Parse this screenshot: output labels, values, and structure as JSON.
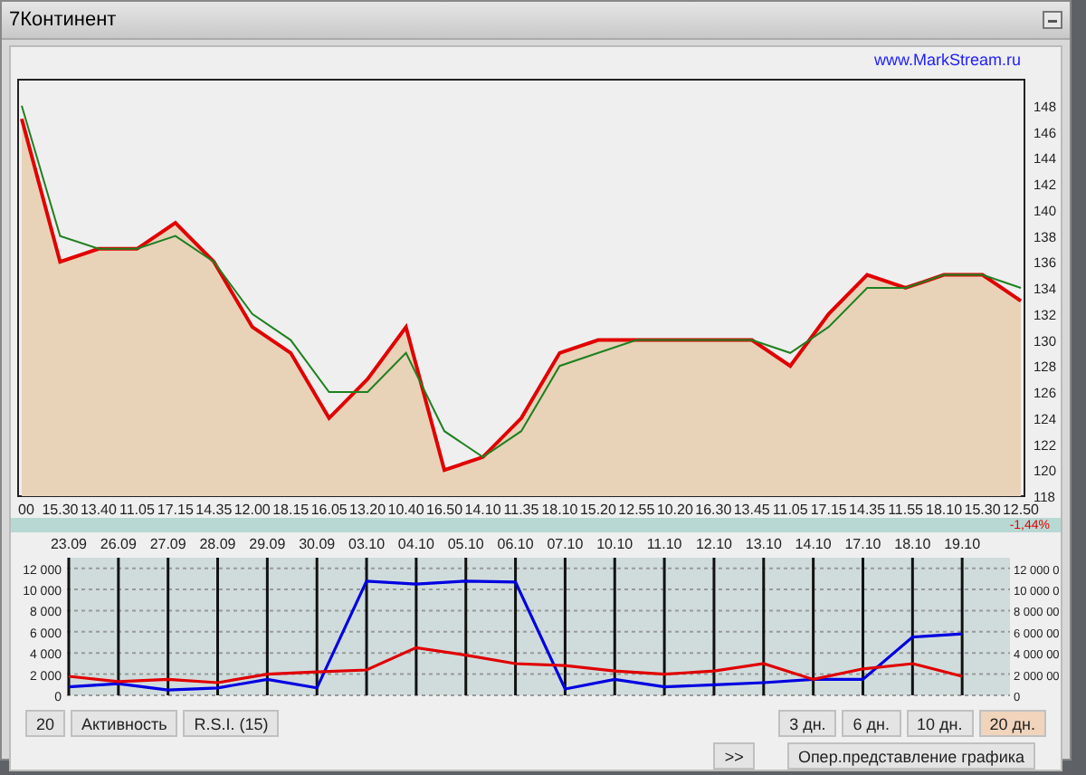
{
  "window": {
    "title": "7Континент"
  },
  "link": "www.MarkStream.ru",
  "price_chart": {
    "chart_data": {
      "type": "area",
      "categories": [
        "00",
        "15.30",
        "13.40",
        "11.05",
        "17.15",
        "14.35",
        "12.00",
        "18.15",
        "16.05",
        "13.20",
        "10.40",
        "16.50",
        "14.10",
        "11.35",
        "18.10",
        "15.20",
        "12.55",
        "10.20",
        "16.30",
        "13.45",
        "11.05",
        "17.15",
        "14.35",
        "11.55",
        "18.10",
        "15.30",
        "12.50"
      ],
      "ylim": [
        118,
        150
      ],
      "yticks": [
        118,
        120,
        122,
        124,
        126,
        128,
        130,
        132,
        134,
        136,
        138,
        140,
        142,
        144,
        146,
        148
      ],
      "series": [
        {
          "color": "#e00000",
          "values": [
            147,
            136,
            137,
            137,
            139,
            136,
            131,
            129,
            124,
            127,
            131,
            120,
            121,
            124,
            129,
            130,
            130,
            130,
            130,
            130,
            128,
            132,
            135,
            134,
            135,
            135,
            133
          ]
        },
        {
          "type": "line",
          "color": "#208020",
          "values": [
            148,
            138,
            137,
            137,
            138,
            136,
            132,
            130,
            126,
            126,
            129,
            123,
            121,
            123,
            128,
            129,
            130,
            130,
            130,
            130,
            129,
            131,
            134,
            134,
            135,
            135,
            134
          ]
        }
      ]
    }
  },
  "change": "-1,44%",
  "volume_chart": {
    "chart_data": {
      "type": "line",
      "categories": [
        "23.09",
        "26.09",
        "27.09",
        "28.09",
        "29.09",
        "30.09",
        "03.10",
        "04.10",
        "05.10",
        "06.10",
        "07.10",
        "10.10",
        "11.10",
        "12.10",
        "13.10",
        "14.10",
        "17.10",
        "18.10",
        "19.10"
      ],
      "ylim": [
        0,
        13000
      ],
      "grid": true,
      "yticks": [
        {
          "value": 0,
          "label": "0"
        },
        {
          "value": 2000,
          "label": "2 000"
        },
        {
          "value": 4000,
          "label": "4 000"
        },
        {
          "value": 6000,
          "label": "6 000"
        },
        {
          "value": 8000,
          "label": "8 000"
        },
        {
          "value": 10000,
          "label": "10 000"
        },
        {
          "value": 12000,
          "label": "12 000"
        }
      ],
      "series": [
        {
          "color": "#0000e0",
          "values": [
            800,
            1100,
            500,
            700,
            1500,
            700,
            10800,
            10500,
            10800,
            10700,
            600,
            1500,
            800,
            1000,
            1200,
            1500,
            1500,
            5500,
            5800
          ]
        },
        {
          "color": "#e00000",
          "values": [
            1800,
            1300,
            1500,
            1200,
            2000,
            2200,
            2400,
            4500,
            3800,
            3000,
            2800,
            2300,
            2000,
            2300,
            3000,
            1500,
            2500,
            3000,
            1800
          ]
        }
      ]
    },
    "right_axis_labels": [
      "12 000 0",
      "10 000 0",
      "8 000 00",
      "6 000 00",
      "4 000 00",
      "2 000 00",
      "0"
    ]
  },
  "left_buttons": [
    {
      "label": "20"
    },
    {
      "label": "Активность"
    },
    {
      "label": "R.S.I. (15)"
    }
  ],
  "period_buttons": [
    {
      "label": "3 дн.",
      "selected": false
    },
    {
      "label": "6 дн.",
      "selected": false
    },
    {
      "label": "10 дн.",
      "selected": false
    },
    {
      "label": "20 дн.",
      "selected": true
    }
  ],
  "scroll_button": ">>",
  "view_button": "Опер.представление графика"
}
